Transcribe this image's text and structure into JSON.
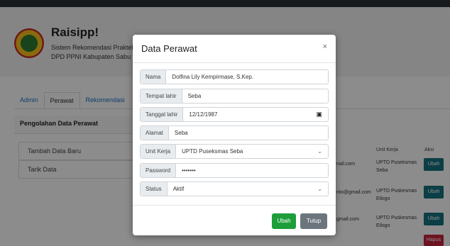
{
  "app": {
    "brand": "Raisipp!",
    "subtitle_line1": "Sistem Rekomendasi Praktek",
    "subtitle_line2": "DPD PPNI Kabupaten Sabu R"
  },
  "tabs": [
    {
      "label": "Admin"
    },
    {
      "label": "Perawat"
    },
    {
      "label": "Rekomendasi"
    }
  ],
  "panel": {
    "title": "Pengolahan Data Perawat",
    "menu": [
      {
        "label": "Tambah Data Baru"
      },
      {
        "label": "Tarik Data"
      }
    ]
  },
  "table": {
    "headers": {
      "unit_kerja": "Unit Kerja",
      "aksi": "Aksi"
    },
    "rows": [
      {
        "email": "nail.com",
        "unit": "UPTD Puseksmas Seba",
        "action": "Ubah"
      },
      {
        "email": "nto@gmail.com",
        "unit": "UPTD Puskesmas Eilogo",
        "action": "Ubah"
      },
      {
        "email": "gmail.com",
        "unit": "UPTD Puskesmas Eilogo",
        "action": "Ubah"
      }
    ],
    "hapus_label": "Hapus"
  },
  "modal": {
    "title": "Data Perawat",
    "close": "×",
    "fields": {
      "nama": {
        "label": "Nama",
        "value": "Dolfina Lily Kempirmase, S.Kep."
      },
      "tempat_lahir": {
        "label": "Tempat lahir",
        "value": "Seba"
      },
      "tanggal_lahir": {
        "label": "Tanggal lahir",
        "value": "12/12/1987"
      },
      "alamat": {
        "label": "Alamat",
        "value": "Seba"
      },
      "unit_kerja": {
        "label": "Unit Kerja",
        "value": "UPTD Puseksmas Seba"
      },
      "password": {
        "label": "Password",
        "value": "•••••••"
      },
      "status": {
        "label": "Status",
        "value": "Aktif"
      }
    },
    "buttons": {
      "ubah": "Ubah",
      "tutup": "Tutup"
    }
  },
  "colors": {
    "tab_link": "#1a73c9",
    "ubah_table_button": "#17717f",
    "hapus_button": "#c8233c",
    "modal_ubah": "#1e9e3a",
    "modal_tutup": "#6c757d"
  }
}
